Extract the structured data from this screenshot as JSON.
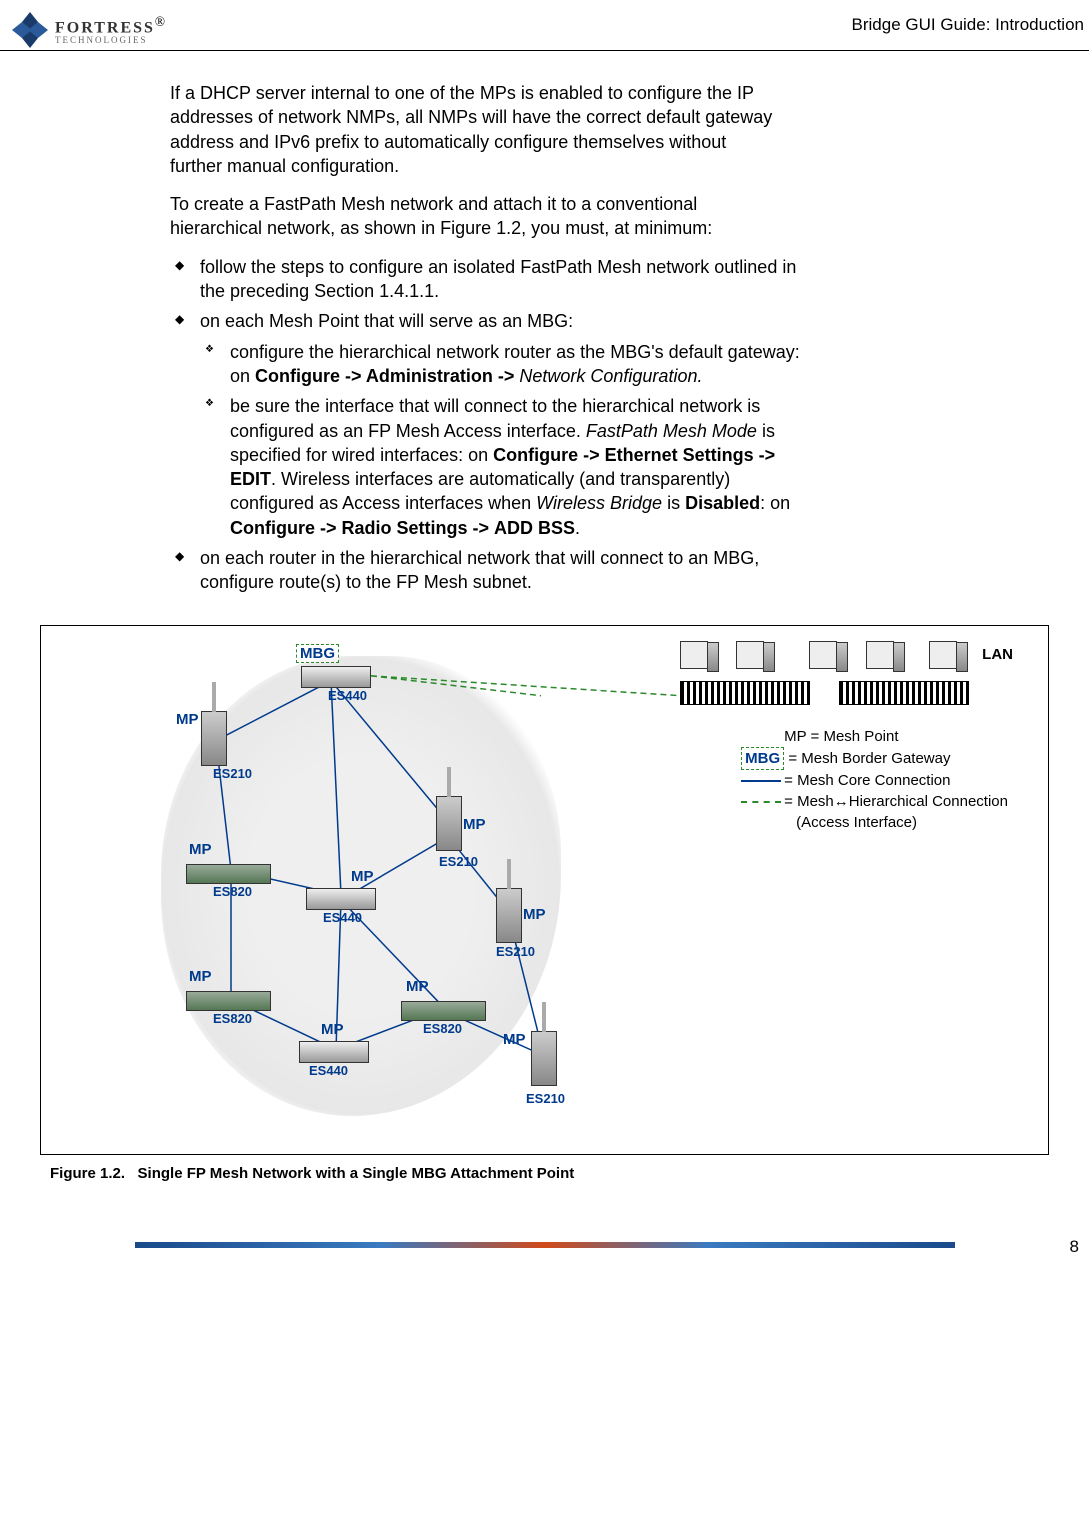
{
  "header": {
    "logo_main": "FORTRESS",
    "logo_sub": "TECHNOLOGIES",
    "logo_reg": "®",
    "right_text": "Bridge GUI Guide: Introduction"
  },
  "body": {
    "p1": "If a DHCP server internal to one of the MPs is enabled to configure the IP addresses of network NMPs, all NMPs will have the correct default gateway address and IPv6 prefix to automatically configure themselves without further manual configuration.",
    "p2": "To create a FastPath Mesh network and attach it to a conventional hierarchical network, as shown in Figure 1.2, you must, at minimum:",
    "b1": "follow the steps to configure an isolated FastPath Mesh network outlined in the preceding Section 1.4.1.1.",
    "b2": "on each Mesh Point that will serve as an MBG:",
    "b2s1_a": "configure the hierarchical network router as the MBG's default gateway: on ",
    "b2s1_bold": "Configure -> Administration -> ",
    "b2s1_ital": "Network Configuration.",
    "b2s2_a": "be sure the interface that will connect to the hierarchical network is configured as an FP Mesh Access interface. ",
    "b2s2_ital1": "FastPath Mesh Mode",
    "b2s2_b": " is specified for wired interfaces: on ",
    "b2s2_bold1": "Configure -> Ethernet Settings -> ",
    "b2s2_sc1": "EDIT",
    "b2s2_c": ". Wireless interfaces are automatically (and transparently) configured as Access interfaces when ",
    "b2s2_ital2": "Wireless Bridge",
    "b2s2_d": " is ",
    "b2s2_bold2": "Disabled",
    "b2s2_e": ": on ",
    "b2s2_bold3": "Configure -> Radio Settings -> ",
    "b2s2_sc2": "ADD BSS",
    "b2s2_f": ".",
    "b3": "on each router in the hierarchical network that will connect to an MBG, configure route(s) to the FP Mesh subnet."
  },
  "figure": {
    "caption_prefix": "Figure 1.2.",
    "caption_text": "Single FP Mesh Network with a Single MBG Attachment Point",
    "lan": "LAN",
    "mbg": "MBG",
    "mp": "MP",
    "models": {
      "es210": "ES210",
      "es440": "ES440",
      "es820": "ES820"
    },
    "legend": {
      "l1": "MP = Mesh Point",
      "l2_pre": "MBG",
      "l2_post": "= Mesh Border Gateway",
      "l3": "= Mesh Core Connection",
      "l4a": "= Mesh↔Hierarchical Connection",
      "l4b": "(Access Interface)"
    }
  },
  "page_number": "8"
}
